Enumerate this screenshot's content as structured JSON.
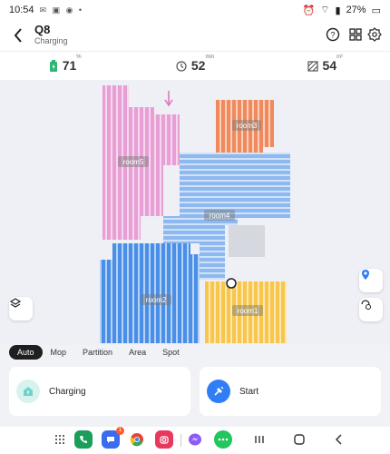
{
  "status": {
    "time": "10:54",
    "battery": "27%"
  },
  "header": {
    "title": "Q8",
    "subtitle": "Charging"
  },
  "stats": {
    "battery": {
      "value": "71",
      "unit": "%"
    },
    "time": {
      "value": "52",
      "unit": "min"
    },
    "area": {
      "value": "54",
      "unit": "m²"
    }
  },
  "rooms": {
    "room1": "room1",
    "room2": "room2",
    "room3": "room3",
    "room4": "room4",
    "room5": "room5"
  },
  "modes": [
    "Auto",
    "Mop",
    "Partition",
    "Area",
    "Spot"
  ],
  "active_mode": "Auto",
  "actions": {
    "charging": "Charging",
    "start": "Start"
  },
  "nav": {
    "messages_badge": "1"
  },
  "colors": {
    "room1": "#f7c64a",
    "room2": "#4a8fe7",
    "room3": "#f08a5d",
    "room4": "#8db8f0",
    "room5": "#e79fd6",
    "accent": "#2f7ef5",
    "charging_tint": "#6fd3c9"
  }
}
